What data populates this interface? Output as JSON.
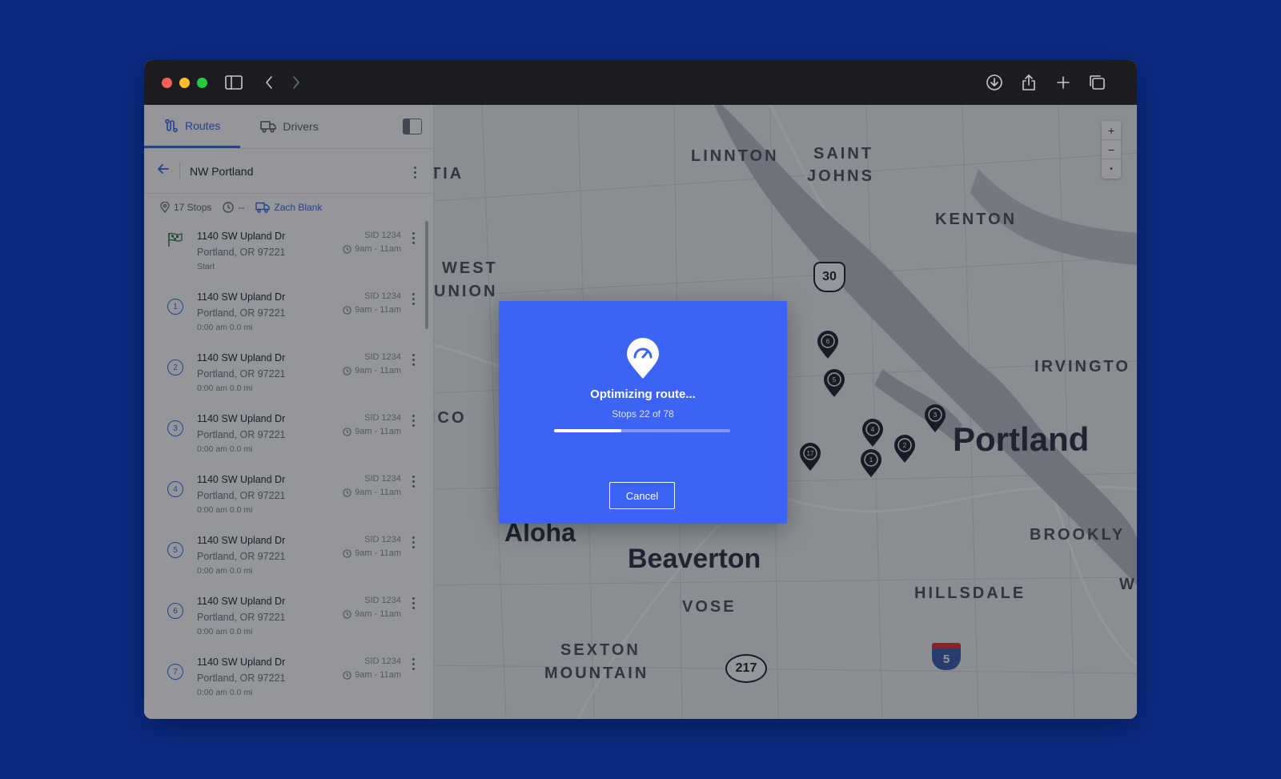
{
  "sidebar": {
    "tabs": [
      {
        "label": "Routes",
        "icon": "route-icon",
        "active": true
      },
      {
        "label": "Drivers",
        "icon": "truck-icon",
        "active": false
      }
    ],
    "route": {
      "title": "NW Portland"
    },
    "meta": {
      "stops": "17 Stops",
      "duration": "--",
      "driver": "Zach Blank"
    },
    "stops": [
      {
        "badge": "",
        "address": "1140 SW Upland Dr",
        "city": "Portland, OR 97221",
        "sub": "Start",
        "sid": "SID 1234",
        "time": "9am - 11am"
      },
      {
        "badge": "1",
        "address": "1140 SW Upland Dr",
        "city": "Portland, OR 97221",
        "sub": "0:00 am 0.0 mi",
        "sid": "SID 1234",
        "time": "9am - 11am"
      },
      {
        "badge": "2",
        "address": "1140 SW Upland Dr",
        "city": "Portland, OR 97221",
        "sub": "0:00 am 0.0 mi",
        "sid": "SID 1234",
        "time": "9am - 11am"
      },
      {
        "badge": "3",
        "address": "1140 SW Upland Dr",
        "city": "Portland, OR 97221",
        "sub": "0:00 am 0.0 mi",
        "sid": "SID 1234",
        "time": "9am - 11am"
      },
      {
        "badge": "4",
        "address": "1140 SW Upland Dr",
        "city": "Portland, OR 97221",
        "sub": "0:00 am 0.0 mi",
        "sid": "SID 1234",
        "time": "9am - 11am"
      },
      {
        "badge": "5",
        "address": "1140 SW Upland Dr",
        "city": "Portland, OR 97221",
        "sub": "0:00 am 0.0 mi",
        "sid": "SID 1234",
        "time": "9am - 11am"
      },
      {
        "badge": "6",
        "address": "1140 SW Upland Dr",
        "city": "Portland, OR 97221",
        "sub": "0:00 am 0.0 mi",
        "sid": "SID 1234",
        "time": "9am - 11am"
      },
      {
        "badge": "7",
        "address": "1140 SW Upland Dr",
        "city": "Portland, OR 97221",
        "sub": "0:00 am 0.0 mi",
        "sid": "SID 1234",
        "time": "9am - 11am"
      }
    ]
  },
  "map": {
    "places": [
      "LINNTON",
      "SAINT",
      "JOHNS",
      "KENTON",
      "TIA",
      "WEST",
      "UNION",
      "IRVINGTO",
      "ICO",
      "BROOKLY",
      "HILLSDALE",
      "VOSE",
      "SEXTON",
      "MOUNTAIN",
      "W"
    ],
    "cities": [
      "Portland",
      "Aloha",
      "Beaverton"
    ],
    "highways": [
      "30",
      "217",
      "5"
    ],
    "pins": [
      "6",
      "5",
      "4",
      "3",
      "2",
      "1",
      "17"
    ],
    "zoom": [
      "+",
      "−",
      "•"
    ]
  },
  "modal": {
    "title": "Optimizing route...",
    "progress_text": "Stops 22 of 78",
    "progress": 0.38,
    "cancel_label": "Cancel"
  },
  "colors": {
    "accent": "#3563e9",
    "modal": "#3d63f5",
    "background": "#0b2a82"
  }
}
